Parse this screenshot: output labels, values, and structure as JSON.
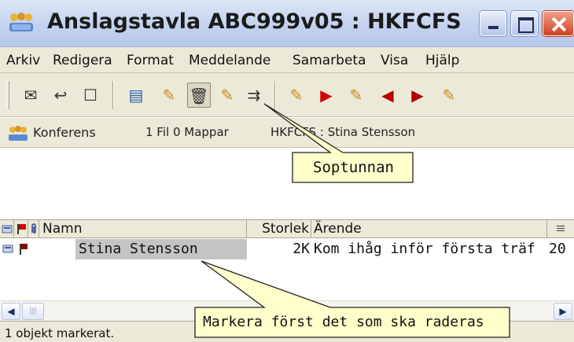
{
  "window": {
    "title": "Anslagstavla ABC999v05 : HKFCFS",
    "icon": "bulletin-board-icon"
  },
  "menu": [
    "Arkiv",
    "Redigera",
    "Format",
    "Meddelande",
    "Samarbeta",
    "Visa",
    "Hjälp"
  ],
  "toolbar": {
    "buttons": [
      {
        "name": "new-message-icon",
        "glyph": "✉"
      },
      {
        "name": "reply-icon",
        "glyph": "↩"
      },
      {
        "name": "new-document-icon",
        "glyph": "☐"
      },
      {
        "name": "properties-icon",
        "glyph": "▤"
      },
      {
        "name": "edit-icon",
        "glyph": "✎"
      },
      {
        "name": "trash-icon",
        "glyph": "🗑"
      },
      {
        "name": "search-icon",
        "glyph": "✎"
      },
      {
        "name": "move-icon",
        "glyph": "⇉"
      },
      {
        "name": "mark-icon",
        "glyph": "✎"
      },
      {
        "name": "flag-icon",
        "glyph": "▶"
      },
      {
        "name": "mark-icon-2",
        "glyph": "✎"
      },
      {
        "name": "previous-icon",
        "glyph": "◀"
      },
      {
        "name": "next-icon",
        "glyph": "▶"
      },
      {
        "name": "mark-icon-3",
        "glyph": "✎"
      }
    ]
  },
  "path_bar": {
    "conference": "Konferens",
    "count": "1 Fil 0 Mappar",
    "location": "HKFCFS : Stina Stensson"
  },
  "list": {
    "columns": [
      "Namn",
      "Storlek",
      "Ärende"
    ],
    "rows": [
      {
        "name": "Stina Stensson",
        "size": "2K",
        "subject": "Kom ihåg inför första träf",
        "date": "20"
      }
    ]
  },
  "status": "1 objekt markerat.",
  "callouts": {
    "trash": "Soptunnan",
    "select": "Markera först det som ska raderas"
  },
  "colors": {
    "title_gradient": "#c3d2ee",
    "chrome": "#ece9d8",
    "callout_fill": "#ffffcc",
    "selection": "#c4c4c4",
    "flag": "#c00000",
    "close_button": "#d2401f"
  }
}
